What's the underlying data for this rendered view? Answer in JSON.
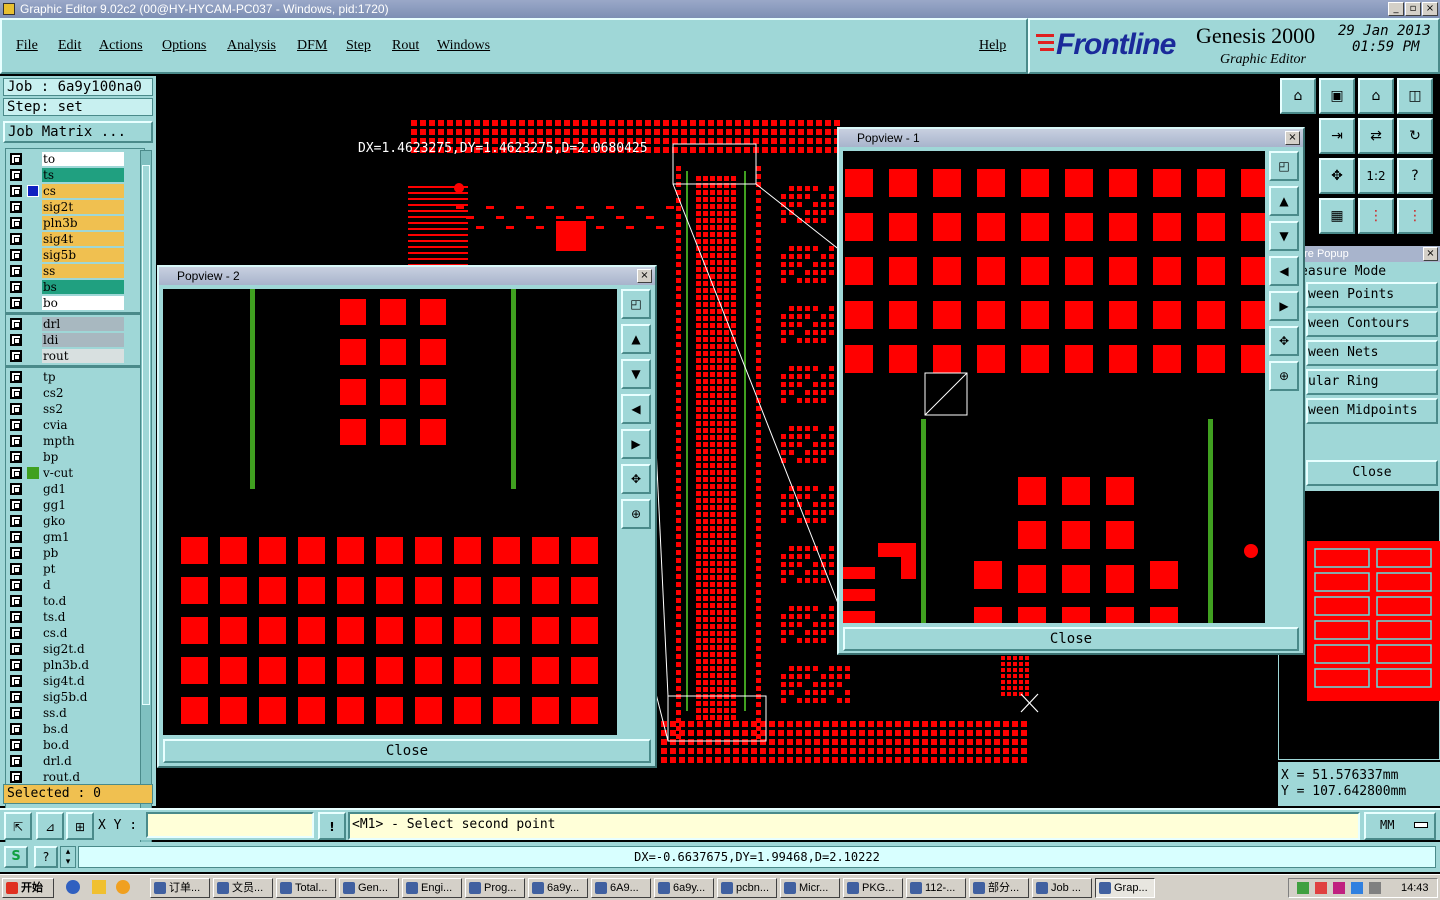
{
  "window": {
    "title": "Graphic Editor 9.02c2 (00@HY-HYCAM-PC037 - Windows, pid:1720)",
    "buttons": [
      "_",
      "▫",
      "×"
    ]
  },
  "menu": {
    "items": [
      "File",
      "Edit",
      "Actions",
      "Options",
      "Analysis",
      "DFM",
      "Step",
      "Rout",
      "Windows"
    ],
    "help": "Help"
  },
  "brand": {
    "logo": "Frontline",
    "product": "Genesis 2000",
    "subtitle": "Graphic Editor",
    "date": "29 Jan 2013",
    "time": "01:59 PM"
  },
  "job": {
    "job_label": "Job  : 6a9y100na0",
    "step_label": "Step: set",
    "matrix_button": "Job Matrix ..."
  },
  "layers": [
    {
      "name": "to",
      "color": "#ffffff"
    },
    {
      "name": "ts",
      "color": "#20a080"
    },
    {
      "name": "cs",
      "color": "#f0c050",
      "active": true
    },
    {
      "name": "sig2t",
      "color": "#f0c050"
    },
    {
      "name": "pln3b",
      "color": "#f0c050"
    },
    {
      "name": "sig4t",
      "color": "#f0c050"
    },
    {
      "name": "sig5b",
      "color": "#f0c050"
    },
    {
      "name": "ss",
      "color": "#f0c050"
    },
    {
      "name": "bs",
      "color": "#20a080"
    },
    {
      "name": "bo",
      "color": "#ffffff"
    },
    {
      "name": "drl",
      "color": "#a8b8c0",
      "sep": true
    },
    {
      "name": "ldi",
      "color": "#a8b8c0"
    },
    {
      "name": "rout",
      "color": "#d8e0e0"
    },
    {
      "name": "tp",
      "color": "#9fd7d7",
      "sep": true
    },
    {
      "name": "cs2",
      "color": "#9fd7d7"
    },
    {
      "name": "ss2",
      "color": "#9fd7d7"
    },
    {
      "name": "cvia",
      "color": "#9fd7d7"
    },
    {
      "name": "mpth",
      "color": "#9fd7d7"
    },
    {
      "name": "bp",
      "color": "#9fd7d7"
    },
    {
      "name": "v-cut",
      "color": "#9fd7d7",
      "swatch": "#40a020"
    },
    {
      "name": "gd1",
      "color": "#9fd7d7"
    },
    {
      "name": "gg1",
      "color": "#9fd7d7"
    },
    {
      "name": "gko",
      "color": "#9fd7d7"
    },
    {
      "name": "gm1",
      "color": "#9fd7d7"
    },
    {
      "name": "pb",
      "color": "#9fd7d7"
    },
    {
      "name": "pt",
      "color": "#9fd7d7"
    },
    {
      "name": "d",
      "color": "#9fd7d7"
    },
    {
      "name": "to.d",
      "color": "#9fd7d7"
    },
    {
      "name": "ts.d",
      "color": "#9fd7d7"
    },
    {
      "name": "cs.d",
      "color": "#9fd7d7"
    },
    {
      "name": "sig2t.d",
      "color": "#9fd7d7"
    },
    {
      "name": "pln3b.d",
      "color": "#9fd7d7"
    },
    {
      "name": "sig4t.d",
      "color": "#9fd7d7"
    },
    {
      "name": "sig5b.d",
      "color": "#9fd7d7"
    },
    {
      "name": "ss.d",
      "color": "#9fd7d7"
    },
    {
      "name": "bs.d",
      "color": "#9fd7d7"
    },
    {
      "name": "bo.d",
      "color": "#9fd7d7"
    },
    {
      "name": "drl.d",
      "color": "#9fd7d7"
    },
    {
      "name": "rout.d",
      "color": "#9fd7d7"
    }
  ],
  "selected": "Selected : 0",
  "canvas": {
    "measure_label": "DX=1.4623275,DY=1.4623275,D=2.0680425"
  },
  "popview2": {
    "title": "Popview - 2",
    "close": "Close"
  },
  "popview1": {
    "title": "Popview - 1",
    "close": "Close"
  },
  "measure_popup": {
    "title": "ure Popup",
    "mode": "easure Mode",
    "items": [
      "ween Points",
      "ween Contours",
      "ween Nets",
      "ular Ring",
      "ween Midpoints"
    ],
    "close": "Close"
  },
  "coords": {
    "x": "X  =  51.576337mm",
    "y": "Y  =  107.642800mm"
  },
  "status": {
    "xy_label": "X Y :",
    "xy_value": "",
    "prompt": "<M1> - Select second point",
    "units": "MM",
    "bottom_measure": "DX=-0.6637675,DY=1.99468,D=2.10222"
  },
  "taskbar": {
    "start": "开始",
    "clock": "14:43",
    "tasks": [
      "订单...",
      "文员...",
      "Total...",
      "Gen...",
      "Engi...",
      "Prog...",
      "6a9y...",
      "6A9...",
      "6a9y...",
      "pcbn...",
      "Micr...",
      "PKG...",
      "112-...",
      "部分...",
      "Job ...",
      "Grap..."
    ]
  },
  "colors": {
    "panel": "#9fd7d7",
    "copper": "#ff0000",
    "vcut": "#40a020"
  }
}
